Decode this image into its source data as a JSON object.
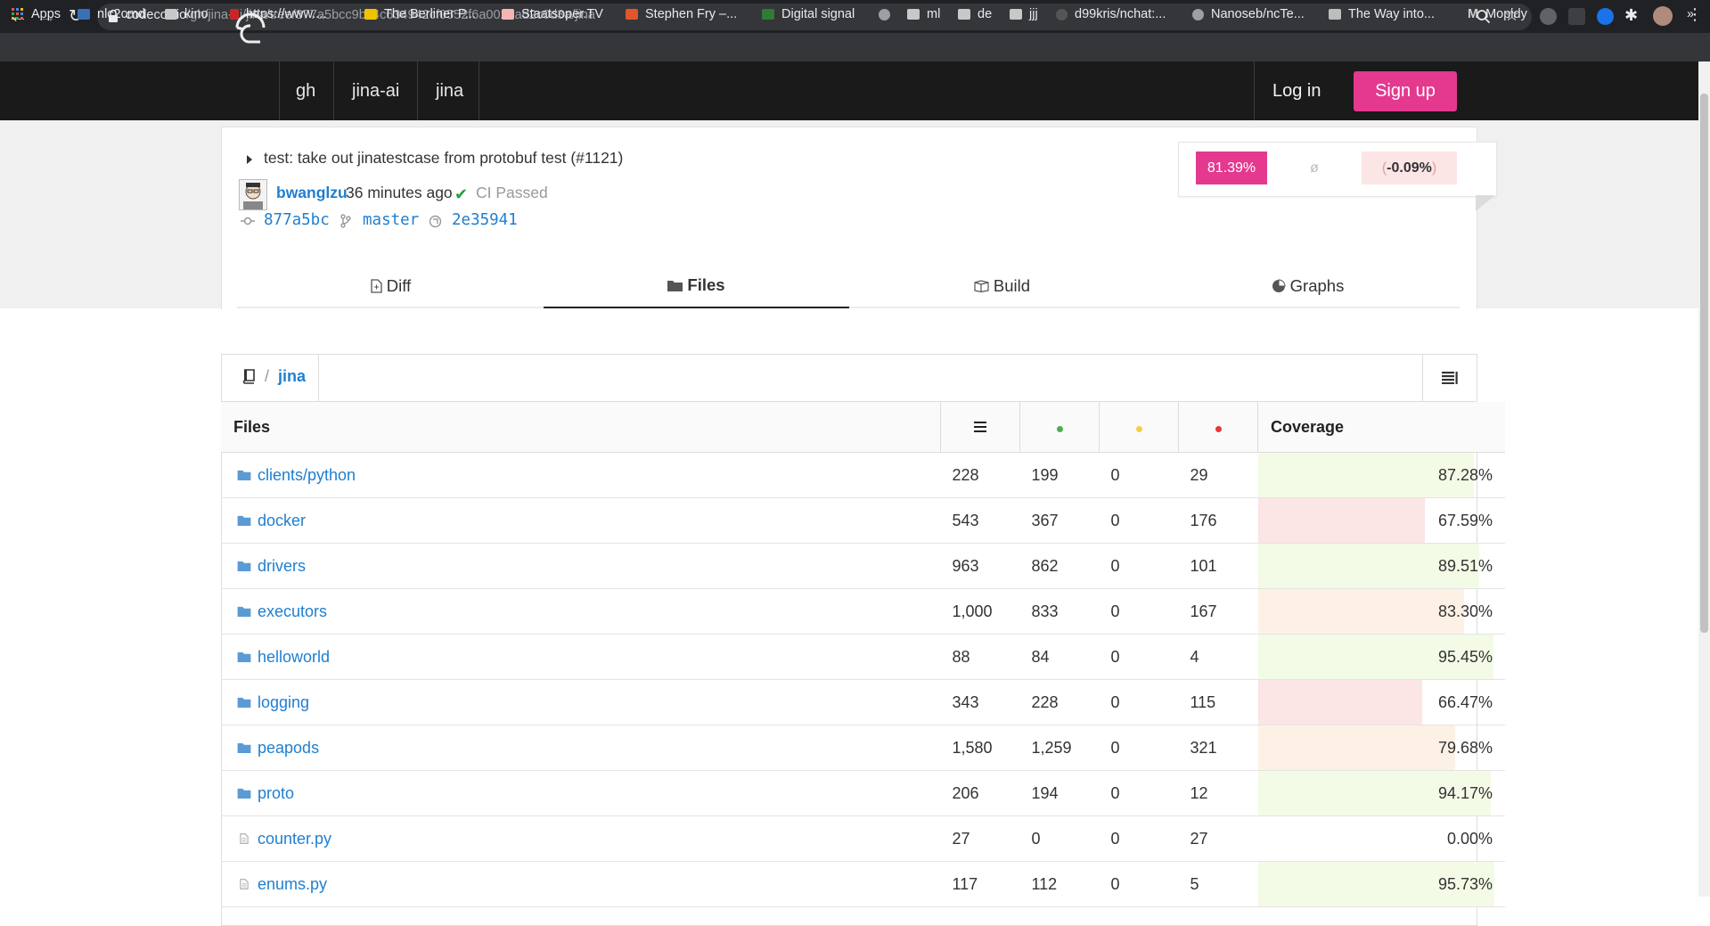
{
  "browser": {
    "url_host": "codecov.io",
    "url_path": "/gh/jina-ai/jina/tree/877a5bcc9bc4c634942cf0552f6a0025ad2c0d3a/jina",
    "bookmarks": [
      "Apps",
      "nlc2cmd",
      "kino",
      "https://www....",
      "The Berliner P...",
      "Staatsoper.TV",
      "Stephen Fry –...",
      "Digital signal",
      "",
      "ml",
      "de",
      "jjj",
      "d99kris/nchat:...",
      "Nanoseb/ncTe...",
      "The Way into...",
      "Mopidy"
    ]
  },
  "header": {
    "crumbs": [
      "gh",
      "jina-ai",
      "jina"
    ],
    "login": "Log in",
    "signup": "Sign up"
  },
  "commit": {
    "message": "test: take out jinatestcase from protobuf test (#1121)",
    "author": "bwanglzu",
    "time_ago": "36 minutes ago",
    "ci_status": "CI Passed",
    "sha": "877a5bc",
    "branch": "master",
    "parent": "2e35941"
  },
  "coverage_summary": {
    "coverage": "81.39%",
    "patch": "ø",
    "change_open": "(",
    "change": "-0.09%",
    "change_close": ")"
  },
  "tabs": [
    {
      "label": "Diff",
      "icon": "file-icon"
    },
    {
      "label": "Files",
      "icon": "folder-icon"
    },
    {
      "label": "Build",
      "icon": "box-icon"
    },
    {
      "label": "Graphs",
      "icon": "pie-icon"
    }
  ],
  "path": {
    "separator": "/",
    "current": "jina"
  },
  "table": {
    "header_files": "Files",
    "header_coverage": "Coverage",
    "colors": {
      "hit": "#4caf50",
      "partial": "#f4d03f",
      "miss": "#e53935"
    },
    "rows": [
      {
        "name": "clients/python",
        "type": "folder",
        "lines": "228",
        "hit": "199",
        "partial": "0",
        "miss": "29",
        "coverage": "87.28%",
        "level": 87.28
      },
      {
        "name": "docker",
        "type": "folder",
        "lines": "543",
        "hit": "367",
        "partial": "0",
        "miss": "176",
        "coverage": "67.59%",
        "level": 67.59
      },
      {
        "name": "drivers",
        "type": "folder",
        "lines": "963",
        "hit": "862",
        "partial": "0",
        "miss": "101",
        "coverage": "89.51%",
        "level": 89.51
      },
      {
        "name": "executors",
        "type": "folder",
        "lines": "1,000",
        "hit": "833",
        "partial": "0",
        "miss": "167",
        "coverage": "83.30%",
        "level": 83.3
      },
      {
        "name": "helloworld",
        "type": "folder",
        "lines": "88",
        "hit": "84",
        "partial": "0",
        "miss": "4",
        "coverage": "95.45%",
        "level": 95.45
      },
      {
        "name": "logging",
        "type": "folder",
        "lines": "343",
        "hit": "228",
        "partial": "0",
        "miss": "115",
        "coverage": "66.47%",
        "level": 66.47
      },
      {
        "name": "peapods",
        "type": "folder",
        "lines": "1,580",
        "hit": "1,259",
        "partial": "0",
        "miss": "321",
        "coverage": "79.68%",
        "level": 79.68
      },
      {
        "name": "proto",
        "type": "folder",
        "lines": "206",
        "hit": "194",
        "partial": "0",
        "miss": "12",
        "coverage": "94.17%",
        "level": 94.17
      },
      {
        "name": "counter.py",
        "type": "file",
        "lines": "27",
        "hit": "0",
        "partial": "0",
        "miss": "27",
        "coverage": "0.00%",
        "level": 0
      },
      {
        "name": "enums.py",
        "type": "file",
        "lines": "117",
        "hit": "112",
        "partial": "0",
        "miss": "5",
        "coverage": "95.73%",
        "level": 95.73
      }
    ]
  }
}
